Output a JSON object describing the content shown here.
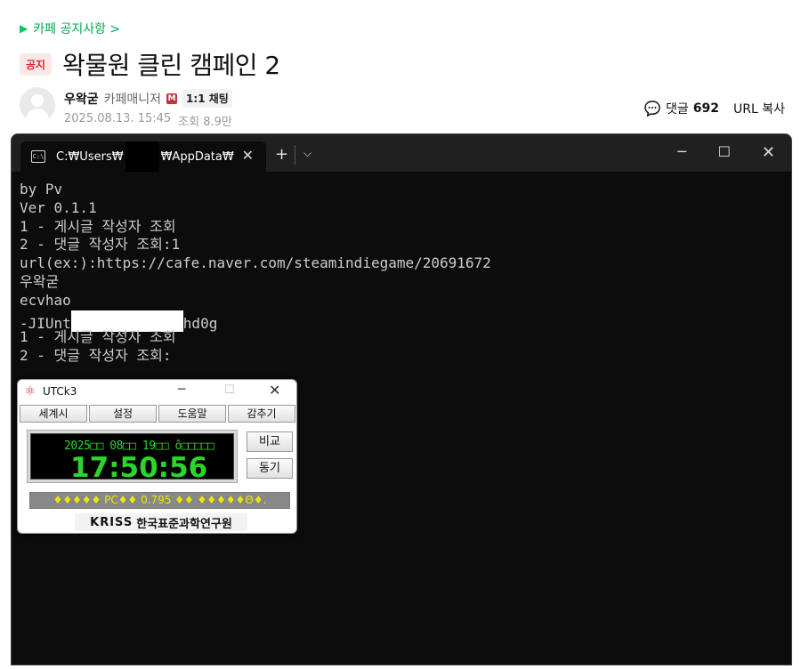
{
  "cafe": {
    "board_link": "카페 공지사항 >",
    "notice_badge": "공지",
    "post_title": "왁물원 클린 캠페인 2",
    "author_name": "우왁굳",
    "author_role": "카페매니저",
    "manager_icon": "M",
    "chat_label": "1:1 채팅",
    "date": "2025.08.13. 15:45",
    "views_label": "조회 8.9만",
    "comment_label": "댓글",
    "comment_count": "692",
    "url_copy": "URL 복사"
  },
  "terminal": {
    "tab_path_prefix": "C:₩Users₩",
    "tab_path_suffix": "₩AppData₩",
    "new_tab": "+",
    "lines": [
      "by Pv",
      "Ver 0.1.1",
      "1 - 게시글 작성자 조회",
      "2 - 댓글 작성자 조회:1",
      "url(ex:):https://cafe.naver.com/steamindiegame/20691672",
      "우왁굳",
      "ecvhao",
      "",
      "1 - 게시글 작성자 조회",
      "2 - 댓글 작성자 조회:"
    ],
    "redacted_line_prefix": "-JIUnt",
    "redacted_line_suffix": "hd0g"
  },
  "utck": {
    "title": "UTCk3",
    "menu": [
      "세계시",
      "설정",
      "도움말",
      "감추기"
    ],
    "clock_date": "2025□□ 08□□ 19□□ ô□□□□□",
    "clock_time": "17:50:56",
    "compare_label": "비교",
    "sync_label": "동기",
    "status_text": "♦♦♦♦♦ PC♦♦ 0.795 ♦♦ ♦♦♦♦♦Θ♦.",
    "logo_text": "KRISS",
    "logo_org": "한국표준과학연구원"
  },
  "icons": {
    "comment": "speech-bubble-icon",
    "terminal": "terminal-icon",
    "utck": "atom-icon"
  },
  "colors": {
    "accent_green": "#03c75a",
    "notice_red": "#e0262a",
    "clock_green": "#2bd62b",
    "status_yellow": "#f0e800"
  }
}
